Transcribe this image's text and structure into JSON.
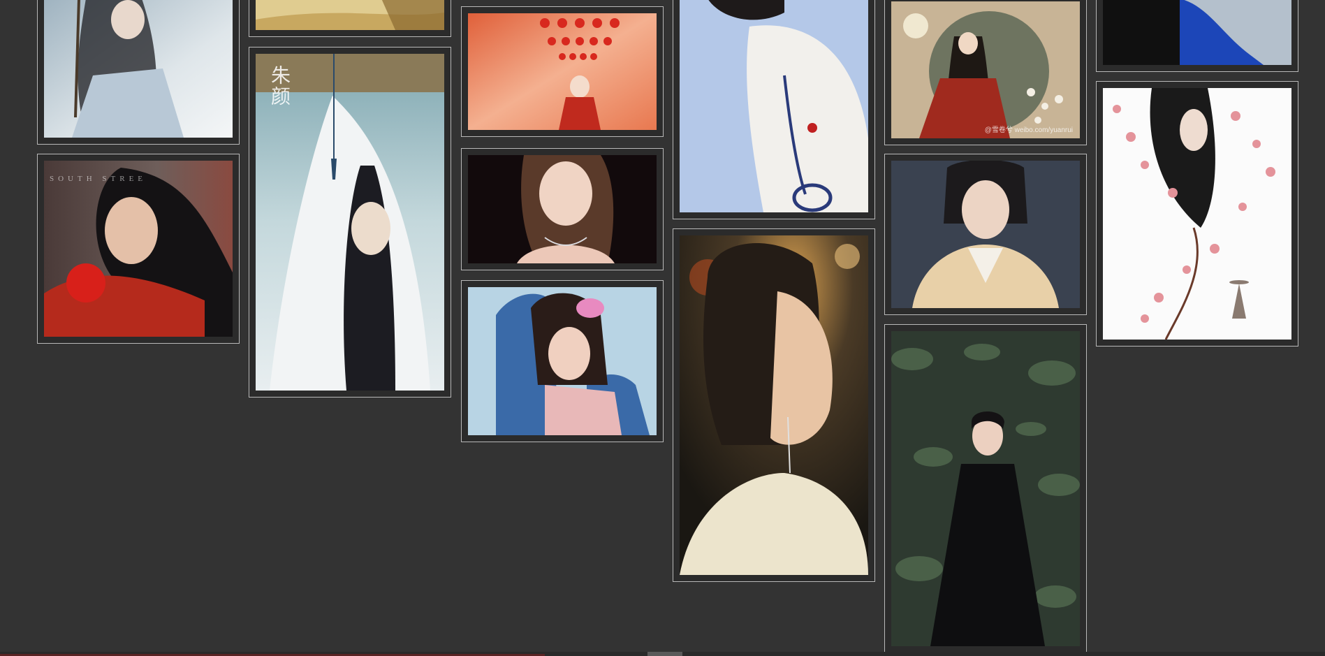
{
  "gallery": {
    "background": "#333333",
    "border_color": "#b9b9b9",
    "cards": [
      {
        "id": "c1",
        "subject": "ink-painting-swordsman"
      },
      {
        "id": "c2",
        "subject": "actress-red-embroidered-robe",
        "watermark": "SOUTH STREE"
      },
      {
        "id": "c3",
        "subject": "golden-fabric-crop"
      },
      {
        "id": "c4",
        "subject": "ink-painting-white-hooded-figure",
        "caption": "朱颜"
      },
      {
        "id": "c5",
        "subject": "illustration-red-lanterns"
      },
      {
        "id": "c6",
        "subject": "actress-diamond-necklace-dark"
      },
      {
        "id": "c7",
        "subject": "actress-pink-top-denim"
      },
      {
        "id": "c8",
        "subject": "model-white-knit-sweater"
      },
      {
        "id": "c9",
        "subject": "actress-profile-braids"
      },
      {
        "id": "c10",
        "subject": "illustration-moon-girl-red-dress",
        "watermark": "@雪卷兮 weibo.com/yuanrui"
      },
      {
        "id": "c11",
        "subject": "actress-hanfu-cream"
      },
      {
        "id": "c12",
        "subject": "actress-black-gown-garden"
      },
      {
        "id": "c13",
        "subject": "blue-sweater-crop"
      },
      {
        "id": "c14",
        "subject": "illustration-plum-blossom-girl"
      }
    ]
  },
  "scrollbar": {
    "position": 0.49
  }
}
